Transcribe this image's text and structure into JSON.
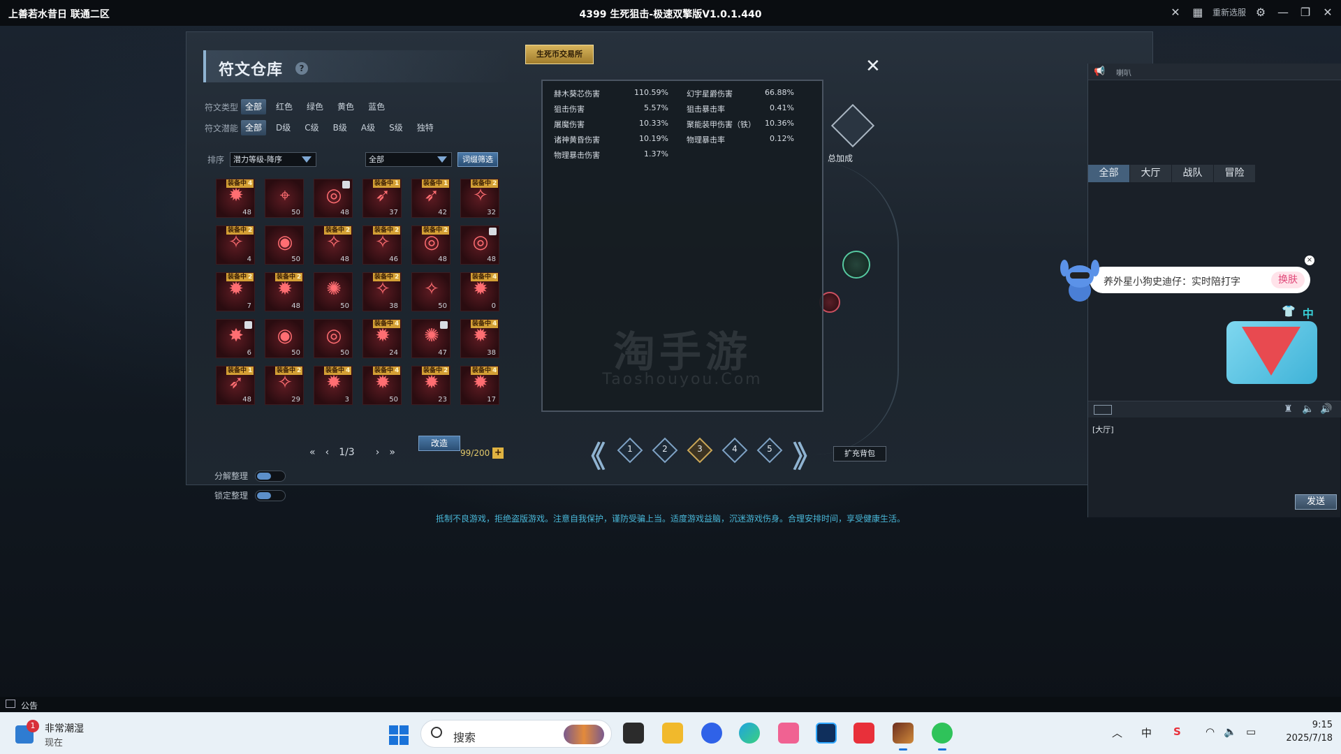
{
  "window": {
    "left_title": "上善若水昔日 联通二区",
    "center_title": "4399 生死狙击-极速双擎版V1.0.1.440",
    "reselect_label": "重新选服"
  },
  "rune_panel": {
    "title": "符文仓库",
    "help_glyph": "?",
    "type_label": "符文类型",
    "type_options": [
      "全部",
      "红色",
      "绿色",
      "黄色",
      "蓝色"
    ],
    "potential_label": "符文潜能",
    "potential_options": [
      "全部",
      "D级",
      "C级",
      "B级",
      "A级",
      "S级",
      "独特"
    ],
    "sort_label": "排序",
    "sort_value": "潜力等级-降序",
    "filter_value": "全部",
    "affix_button": "词缀筛选",
    "equip_tag": "装备中",
    "runes": [
      {
        "glyph": "✹",
        "lvl": "48",
        "equip": "4",
        "lock": false
      },
      {
        "glyph": "⌖",
        "lvl": "50",
        "equip": "",
        "lock": false
      },
      {
        "glyph": "◎",
        "lvl": "48",
        "equip": "",
        "lock": true
      },
      {
        "glyph": "➶",
        "lvl": "37",
        "equip": "1",
        "lock": false
      },
      {
        "glyph": "➶",
        "lvl": "42",
        "equip": "1",
        "lock": false
      },
      {
        "glyph": "✧",
        "lvl": "32",
        "equip": "2",
        "lock": false
      },
      {
        "glyph": "✧",
        "lvl": "4",
        "equip": "2",
        "lock": false
      },
      {
        "glyph": "◉",
        "lvl": "50",
        "equip": "",
        "lock": false
      },
      {
        "glyph": "✧",
        "lvl": "48",
        "equip": "2",
        "lock": false
      },
      {
        "glyph": "✧",
        "lvl": "46",
        "equip": "2",
        "lock": false
      },
      {
        "glyph": "◎",
        "lvl": "48",
        "equip": "2",
        "lock": false
      },
      {
        "glyph": "◎",
        "lvl": "48",
        "equip": "",
        "lock": true
      },
      {
        "glyph": "✹",
        "lvl": "7",
        "equip": "2",
        "lock": false
      },
      {
        "glyph": "✹",
        "lvl": "48",
        "equip": "2",
        "lock": false
      },
      {
        "glyph": "✺",
        "lvl": "50",
        "equip": "",
        "lock": false
      },
      {
        "glyph": "✧",
        "lvl": "38",
        "equip": "2",
        "lock": false
      },
      {
        "glyph": "✧",
        "lvl": "50",
        "equip": "",
        "lock": false
      },
      {
        "glyph": "✹",
        "lvl": "0",
        "equip": "4",
        "lock": false
      },
      {
        "glyph": "✸",
        "lvl": "6",
        "equip": "",
        "lock": true
      },
      {
        "glyph": "◉",
        "lvl": "50",
        "equip": "",
        "lock": false
      },
      {
        "glyph": "◎",
        "lvl": "50",
        "equip": "",
        "lock": false
      },
      {
        "glyph": "✹",
        "lvl": "24",
        "equip": "4",
        "lock": false
      },
      {
        "glyph": "✺",
        "lvl": "47",
        "equip": "",
        "lock": true
      },
      {
        "glyph": "✹",
        "lvl": "38",
        "equip": "4",
        "lock": false
      },
      {
        "glyph": "➶",
        "lvl": "48",
        "equip": "1",
        "lock": false
      },
      {
        "glyph": "✧",
        "lvl": "29",
        "equip": "2",
        "lock": false
      },
      {
        "glyph": "✹",
        "lvl": "3",
        "equip": "4",
        "lock": false
      },
      {
        "glyph": "✹",
        "lvl": "50",
        "equip": "4",
        "lock": false
      },
      {
        "glyph": "✹",
        "lvl": "23",
        "equip": "2",
        "lock": false
      },
      {
        "glyph": "✹",
        "lvl": "17",
        "equip": "4",
        "lock": false
      }
    ],
    "pager": {
      "first": "«",
      "prev": "‹",
      "page": "1/3",
      "next": "›",
      "last": "»"
    },
    "capacity": "99/200",
    "capacity_plus": "+",
    "decompose_label": "分解整理",
    "lock_label": "锁定整理",
    "reforge_button": "改造"
  },
  "middle": {
    "trade_button": "生死币交易所",
    "close_glyph": "✕",
    "total_label": "总加成",
    "stats": [
      {
        "name": "赫木葵芯伤害",
        "value": "110.59%"
      },
      {
        "name": "幻宇星爵伤害",
        "value": "66.88%"
      },
      {
        "name": "狙击伤害",
        "value": "5.57%"
      },
      {
        "name": "狙击暴击率",
        "value": "0.41%"
      },
      {
        "name": "屠魔伤害",
        "value": "10.33%"
      },
      {
        "name": "聚能装甲伤害（铁）",
        "value": "10.36%"
      },
      {
        "name": "诸神黄昏伤害",
        "value": "10.19%"
      },
      {
        "name": "物理暴击率",
        "value": "0.12%"
      },
      {
        "name": "物理暴击伤害",
        "value": "1.37%"
      }
    ],
    "watermark": "淘手游",
    "watermark_sub": "Taoshouyou.Com",
    "page_prev": "《",
    "page_next": "》",
    "pages": [
      "1",
      "2",
      "3",
      "4",
      "5"
    ],
    "active_page": 2,
    "expand_button": "扩充背包"
  },
  "chat": {
    "top_label": "喇叭",
    "tabs": [
      "全部",
      "大厅",
      "战队",
      "冒险"
    ],
    "channel": "[大厅]",
    "send_button": "发送"
  },
  "bubble": {
    "text": "养外星小狗史迪仔：实时陪打字",
    "skin_button": "换肤",
    "close_glyph": "×",
    "widget_glyph_1": "👕",
    "widget_glyph_2": "中"
  },
  "health_notice": "抵制不良游戏，拒绝盗版游戏。注意自我保护，谨防受骗上当。适度游戏益脑，沉迷游戏伤身。合理安排时间，享受健康生活。",
  "announcement": "公告",
  "taskbar": {
    "weather_badge": "1",
    "weather_title": "非常潮湿",
    "weather_sub": "现在",
    "search_label": "搜索",
    "ime": "中",
    "time": "9:15",
    "date": "2025/7/18"
  }
}
